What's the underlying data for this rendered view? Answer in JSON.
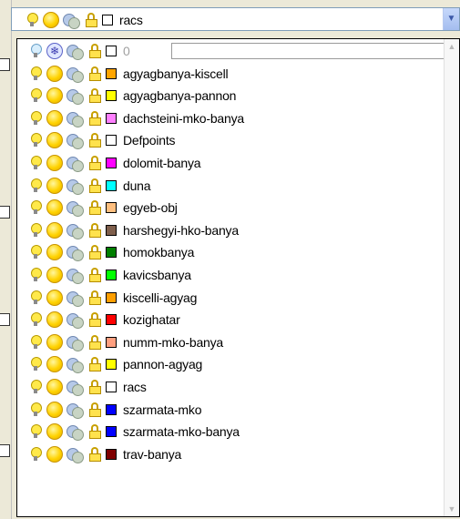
{
  "combo": {
    "name": "racs",
    "color": "#ffffff",
    "dropdown_icon": "chevron-down-icon"
  },
  "layers": [
    {
      "name": "0",
      "color": "#ffffff",
      "on": false,
      "frozen": true
    },
    {
      "name": "agyagbanya-kiscell",
      "color": "#ffa500"
    },
    {
      "name": "agyagbanya-pannon",
      "color": "#ffff00"
    },
    {
      "name": "dachsteini-mko-banya",
      "color": "#ff7fff"
    },
    {
      "name": "Defpoints",
      "color": "#ffffff"
    },
    {
      "name": "dolomit-banya",
      "color": "#ff00ff"
    },
    {
      "name": "duna",
      "color": "#00ffff"
    },
    {
      "name": "egyeb-obj",
      "color": "#ffbf7f"
    },
    {
      "name": "harshegyi-hko-banya",
      "color": "#7f5f4c"
    },
    {
      "name": "homokbanya",
      "color": "#007f00"
    },
    {
      "name": "kavicsbanya",
      "color": "#00ff00"
    },
    {
      "name": "kiscelli-agyag",
      "color": "#ff9f00"
    },
    {
      "name": "kozighatar",
      "color": "#ff0000"
    },
    {
      "name": "numm-mko-banya",
      "color": "#ff9f7f"
    },
    {
      "name": "pannon-agyag",
      "color": "#ffff00"
    },
    {
      "name": "racs",
      "color": "#ffffff"
    },
    {
      "name": "szarmata-mko",
      "color": "#0000ff"
    },
    {
      "name": "szarmata-mko-banya",
      "color": "#0000ff"
    },
    {
      "name": "trav-banya",
      "color": "#7f0000"
    }
  ]
}
